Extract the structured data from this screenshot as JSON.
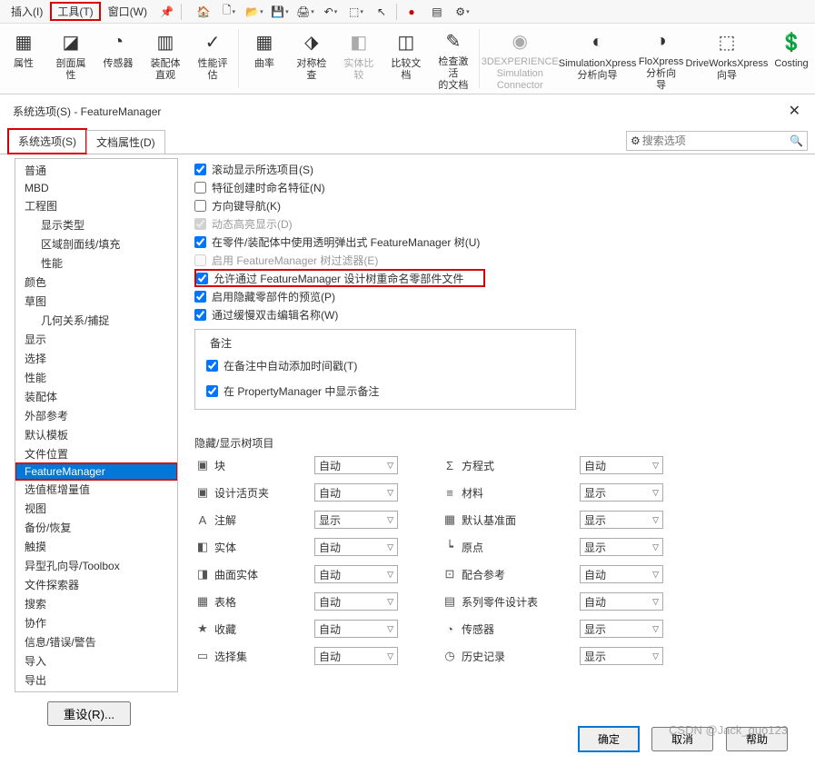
{
  "menubar": {
    "insert": "插入(I)",
    "tools": "工具(T)",
    "window": "窗口(W)"
  },
  "ribbon": [
    {
      "label": "属性",
      "dis": false
    },
    {
      "label": "剖面属\n性",
      "dis": false
    },
    {
      "label": "传感器",
      "dis": false
    },
    {
      "label": "装配体\n直观",
      "dis": false
    },
    {
      "label": "性能评\n估",
      "dis": false
    },
    {
      "label": "曲率",
      "dis": false
    },
    {
      "label": "对称检\n查",
      "dis": false
    },
    {
      "label": "实体比\n较",
      "dis": true
    },
    {
      "label": "比较文\n档",
      "dis": false
    },
    {
      "label": "检查激活\n的文档",
      "dis": false
    },
    {
      "label": "3DEXPERIENCE\nSimulation\nConnector",
      "dis": true
    },
    {
      "label": "SimulationXpress\n分析向导",
      "dis": false
    },
    {
      "label": "FloXpress\n分析向\n导",
      "dis": false
    },
    {
      "label": "DriveWorksXpress\n向导",
      "dis": false
    },
    {
      "label": "Costing",
      "dis": false
    }
  ],
  "dialog": {
    "title": "系统选项(S) - FeatureManager",
    "tab_system": "系统选项(S)",
    "tab_docprops": "文档属性(D)",
    "search_placeholder": "搜索选项"
  },
  "sidebar": [
    {
      "label": "普通"
    },
    {
      "label": "MBD"
    },
    {
      "label": "工程图"
    },
    {
      "label": "显示类型",
      "sub": true
    },
    {
      "label": "区域剖面线/填充",
      "sub": true
    },
    {
      "label": "性能",
      "sub": true
    },
    {
      "label": "颜色"
    },
    {
      "label": "草图"
    },
    {
      "label": "几何关系/捕捉",
      "sub": true
    },
    {
      "label": "显示"
    },
    {
      "label": "选择"
    },
    {
      "label": "性能"
    },
    {
      "label": "装配体"
    },
    {
      "label": "外部参考"
    },
    {
      "label": "默认模板"
    },
    {
      "label": "文件位置"
    },
    {
      "label": "FeatureManager",
      "selected": true,
      "hl": true
    },
    {
      "label": "选值框增量值"
    },
    {
      "label": "视图"
    },
    {
      "label": "备份/恢复"
    },
    {
      "label": "触摸"
    },
    {
      "label": "异型孔向导/Toolbox"
    },
    {
      "label": "文件探索器"
    },
    {
      "label": "搜索"
    },
    {
      "label": "协作"
    },
    {
      "label": "信息/错误/警告"
    },
    {
      "label": "导入"
    },
    {
      "label": "导出"
    }
  ],
  "reset_btn": "重设(R)...",
  "checks": [
    {
      "label": "滚动显示所选项目(S)",
      "checked": true
    },
    {
      "label": "特征创建时命名特征(N)",
      "checked": false
    },
    {
      "label": "方向键导航(K)",
      "checked": false
    },
    {
      "label": "动态高亮显示(D)",
      "checked": true,
      "dis": true
    },
    {
      "label": "在零件/装配体中使用透明弹出式 FeatureManager 树(U)",
      "checked": true
    },
    {
      "label": "启用 FeatureManager 树过滤器(E)",
      "checked": false,
      "dis": true
    },
    {
      "label": "允许通过 FeatureManager 设计树重命名零部件文件",
      "checked": true,
      "hl": true
    },
    {
      "label": "启用隐藏零部件的预览(P)",
      "checked": true
    },
    {
      "label": "通过缓慢双击编辑名称(W)",
      "checked": true
    }
  ],
  "notes": {
    "legend": "备注",
    "add_timestamp": "在备注中自动添加时间戳(T)",
    "show_in_pm": "在 PropertyManager 中显示备注"
  },
  "tree": {
    "title": "隐藏/显示树项目",
    "rows": [
      {
        "l_label": "块",
        "l_val": "自动",
        "r_label": "方程式",
        "r_val": "自动"
      },
      {
        "l_label": "设计活页夹",
        "l_val": "自动",
        "r_label": "材料",
        "r_val": "显示"
      },
      {
        "l_label": "注解",
        "l_val": "显示",
        "r_label": "默认基准面",
        "r_val": "显示"
      },
      {
        "l_label": "实体",
        "l_val": "自动",
        "r_label": "原点",
        "r_val": "显示"
      },
      {
        "l_label": "曲面实体",
        "l_val": "自动",
        "r_label": "配合参考",
        "r_val": "自动"
      },
      {
        "l_label": "表格",
        "l_val": "自动",
        "r_label": "系列零件设计表",
        "r_val": "自动"
      },
      {
        "l_label": "收藏",
        "l_val": "自动",
        "r_label": "传感器",
        "r_val": "显示"
      },
      {
        "l_label": "选择集",
        "l_val": "自动",
        "r_label": "历史记录",
        "r_val": "显示"
      }
    ]
  },
  "buttons": {
    "ok": "确定",
    "cancel": "取消",
    "help": "帮助"
  },
  "watermark": "CSDN @Jack_guo123"
}
